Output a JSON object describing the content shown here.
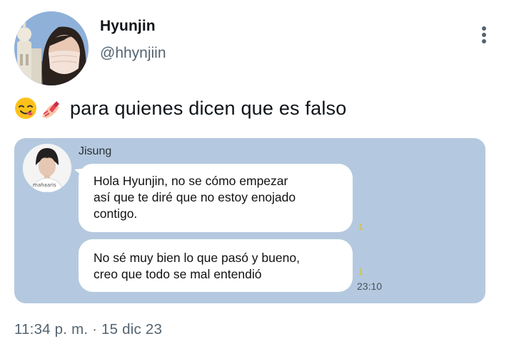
{
  "author": {
    "display_name": "Hyunjin",
    "handle": "@hhynjiin",
    "avatar_icon": "profile-photo"
  },
  "menu": {
    "icon": "more-vertical-icon"
  },
  "tweet": {
    "emojis": [
      "face-savoring-food-emoji",
      "nail-polish-emoji"
    ],
    "text": "para quienes dicen que es falso"
  },
  "screenshot": {
    "background_color": "#b4c9df",
    "contact": {
      "name": "Jisung",
      "avatar_icon": "contact-avatar",
      "avatar_watermark": "mahaaris"
    },
    "messages": [
      {
        "lines": [
          "Hola Hyunjin, no se cómo empezar",
          "así que te diré que no estoy enojado",
          "contigo."
        ],
        "read_count": "1"
      },
      {
        "lines": [
          "No sé muy bien lo que pasó y bueno,",
          "creo que todo se mal entendió"
        ],
        "read_count": "1",
        "time": "23:10"
      }
    ]
  },
  "timestamp": "11:34 p. m. · 15 dic 23"
}
